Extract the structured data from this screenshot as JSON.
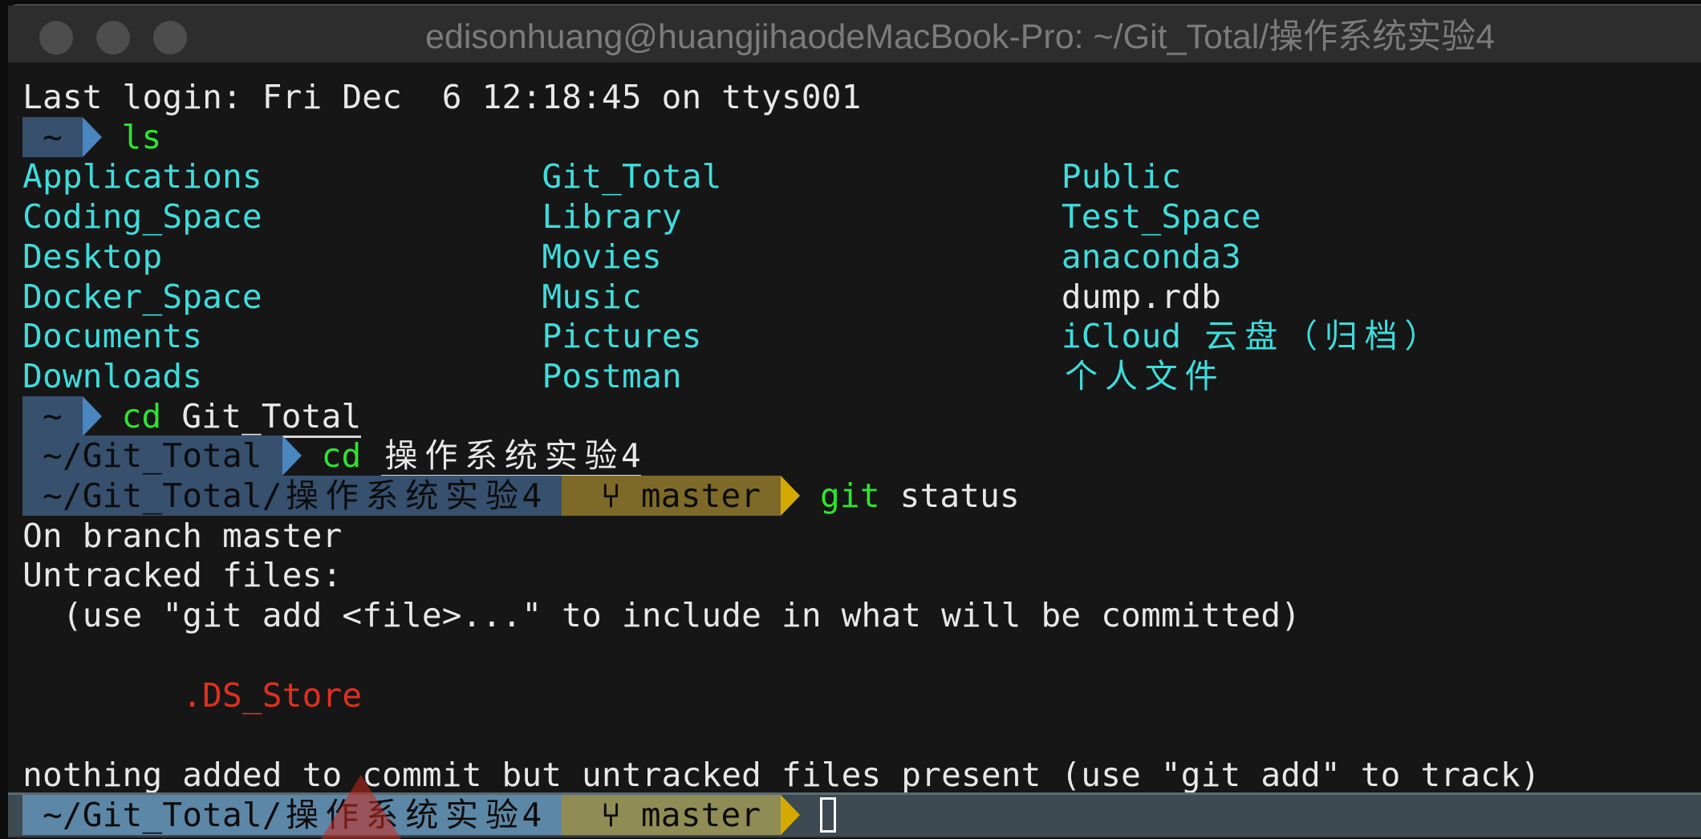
{
  "window": {
    "title": "edisonhuang@huangjihaodeMacBook-Pro: ~/Git_Total/操作系统实验4",
    "traffic_lights": [
      "close",
      "minimize",
      "zoom"
    ]
  },
  "colors": {
    "background": "#161616",
    "directory": "#3fdcdc",
    "command": "#2ee52e",
    "untracked_file": "#e0301e",
    "prompt_dir_segment": "#36506e",
    "prompt_git_segment": "#7d6a28",
    "prompt_arrow_dir": "#4a86c0",
    "prompt_arrow_git": "#d4aa00"
  },
  "terminal": {
    "last_login": "Last login: Fri Dec  6 12:18:45 on ttys001",
    "prompt1": {
      "dir": "~",
      "cmd": "ls",
      "args": ""
    },
    "ls_output": {
      "col1": [
        "Applications",
        "Coding_Space",
        "Desktop",
        "Docker_Space",
        "Documents",
        "Downloads"
      ],
      "col2": [
        "Git_Total",
        "Library",
        "Movies",
        "Music",
        "Pictures",
        "Postman"
      ],
      "col3": [
        {
          "name": "Public",
          "type": "dir"
        },
        {
          "name": "Test_Space",
          "type": "dir"
        },
        {
          "name": "anaconda3",
          "type": "dir"
        },
        {
          "name": "dump.rdb",
          "type": "file"
        },
        {
          "name": "iCloud 云盘（归档）",
          "type": "dir"
        },
        {
          "name": "个人文件",
          "type": "dir"
        }
      ]
    },
    "prompt2": {
      "dir": "~",
      "cmd": "cd",
      "args": "Git_Total"
    },
    "prompt3": {
      "dir": "~/Git_Total",
      "cmd": "cd",
      "args": "操作系统实验4"
    },
    "prompt4": {
      "dir": "~/Git_Total/操作系统实验4",
      "branch_icon": "git-branch-icon",
      "branch": "master",
      "cmd": "git",
      "args": "status"
    },
    "git_output": {
      "line1": "On branch master",
      "line2": "Untracked files:",
      "line3": "  (use \"git add <file>...\" to include in what will be committed)",
      "untracked": ".DS_Store",
      "summary": "nothing added to commit but untracked files present (use \"git add\" to track)"
    },
    "prompt5": {
      "dir": "~/Git_Total/操作系统实验4",
      "branch_icon": "git-branch-icon",
      "branch": "master",
      "cmd": ""
    }
  }
}
